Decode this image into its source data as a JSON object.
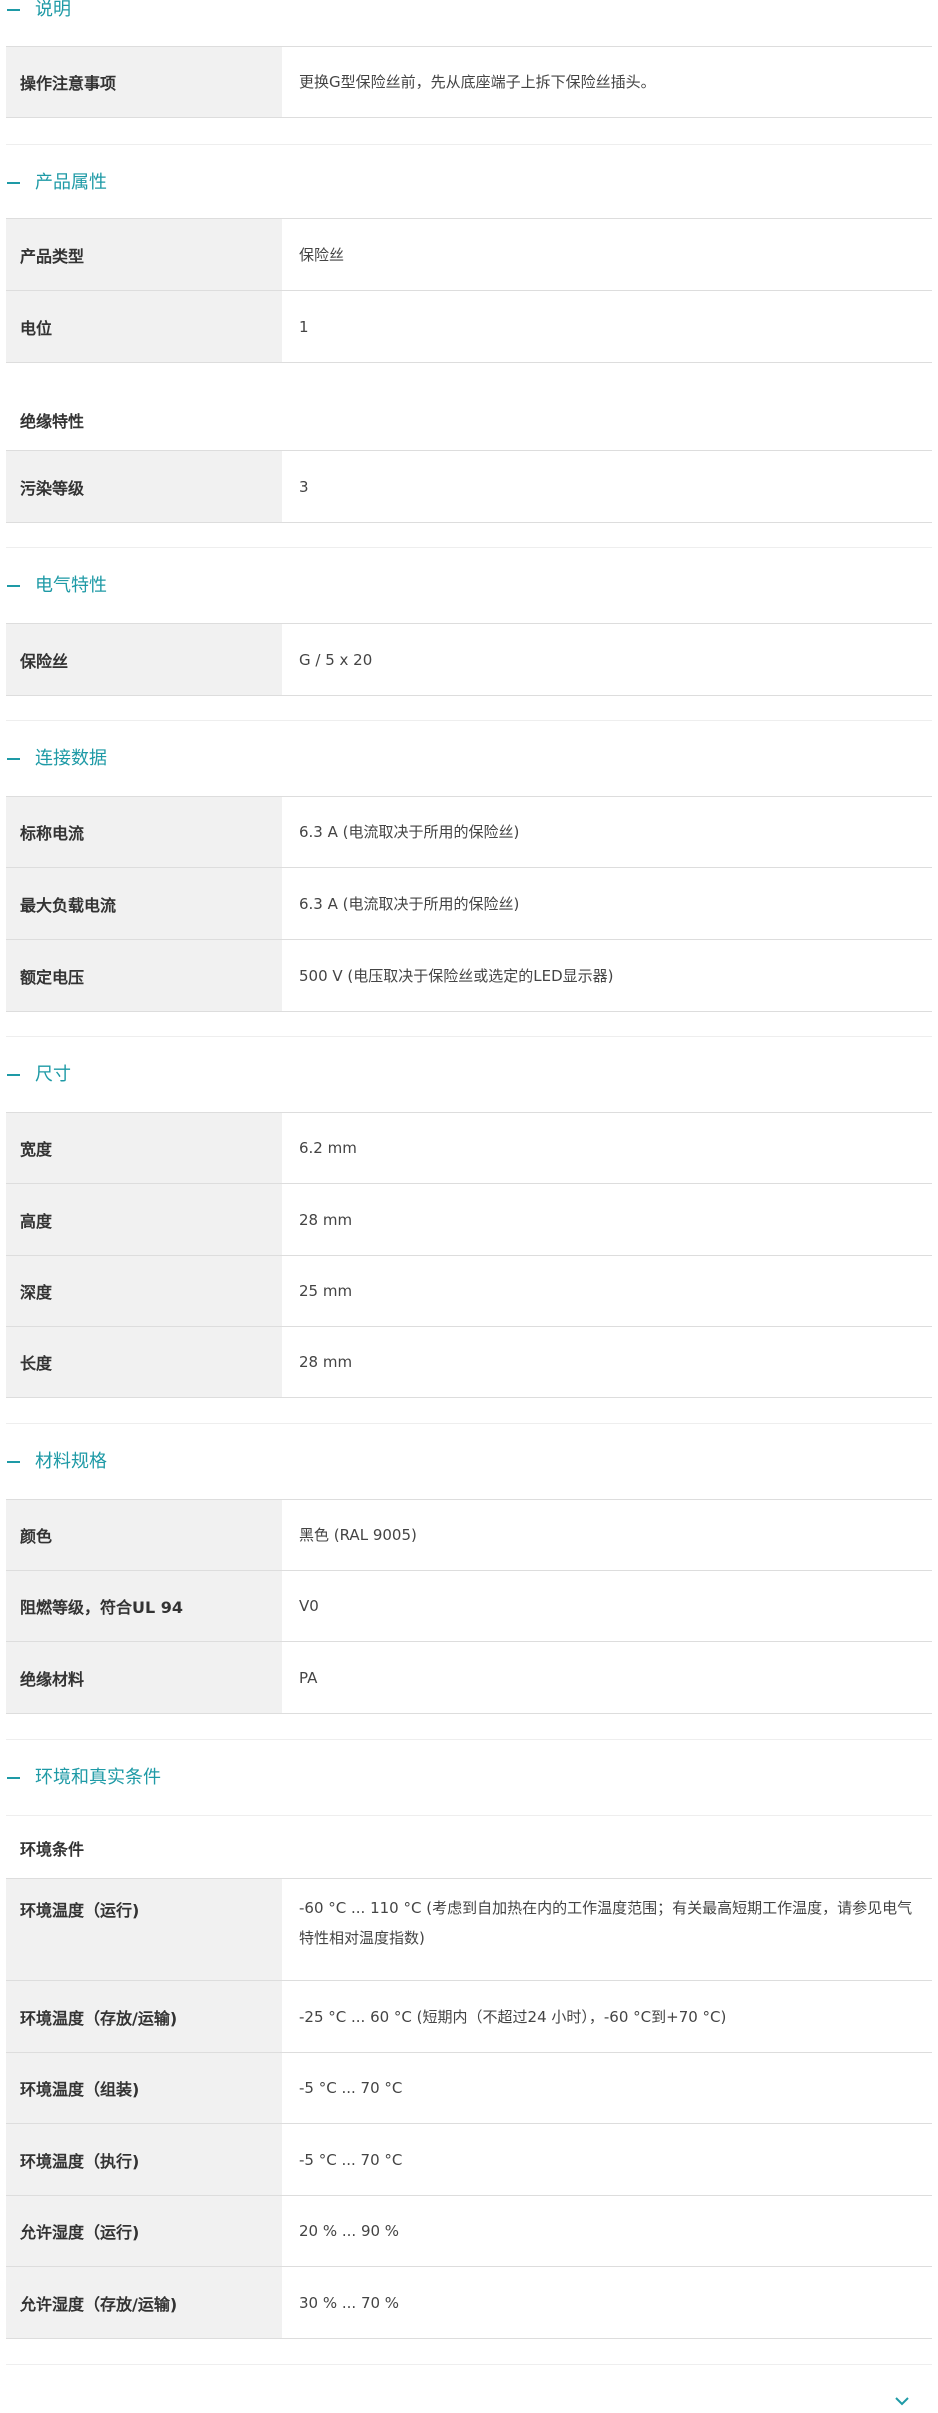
{
  "sections": {
    "description": {
      "title": "说明",
      "rows": [
        {
          "key": "操作注意事项",
          "value": "更换G型保险丝前，先从底座端子上拆下保险丝插头。"
        }
      ]
    },
    "product_properties": {
      "title": "产品属性",
      "rows": [
        {
          "key": "产品类型",
          "value": "保险丝"
        },
        {
          "key": "电位",
          "value": "1"
        }
      ],
      "subhead": "绝缘特性",
      "subrows": [
        {
          "key": "污染等级",
          "value": "3"
        }
      ]
    },
    "electrical": {
      "title": "电气特性",
      "rows": [
        {
          "key": "保险丝",
          "value": "G / 5 x 20"
        }
      ]
    },
    "connection": {
      "title": "连接数据",
      "rows": [
        {
          "key": "标称电流",
          "value": "6.3 A (电流取决于所用的保险丝)"
        },
        {
          "key": "最大负载电流",
          "value": "6.3 A (电流取决于所用的保险丝)"
        },
        {
          "key": "额定电压",
          "value": "500 V (电压取决于保险丝或选定的LED显示器)"
        }
      ]
    },
    "dimensions": {
      "title": "尺寸",
      "rows": [
        {
          "key": "宽度",
          "value": "6.2 mm"
        },
        {
          "key": "高度",
          "value": "28 mm"
        },
        {
          "key": "深度",
          "value": "25 mm"
        },
        {
          "key": "长度",
          "value": "28 mm"
        }
      ]
    },
    "material": {
      "title": "材料规格",
      "rows": [
        {
          "key": "颜色",
          "value": "黑色 (RAL 9005)"
        },
        {
          "key": "阻燃等级，符合UL 94",
          "value": "V0"
        },
        {
          "key": "绝缘材料",
          "value": "PA"
        }
      ]
    },
    "environment": {
      "title": "环境和真实条件",
      "subhead": "环境条件",
      "rows": [
        {
          "key": "环境温度（运行)",
          "value": "-60 °C ... 110 °C (考虑到自加热在内的工作温度范围；有关最高短期工作温度，请参见电气特性相对温度指数)"
        },
        {
          "key": "环境温度（存放/运输)",
          "value": "-25 °C ... 60 °C (短期内（不超过24 小时），-60 °C到+70 °C)"
        },
        {
          "key": "环境温度（组装)",
          "value": "-5 °C ... 70 °C"
        },
        {
          "key": "环境温度（执行)",
          "value": "-5 °C ... 70 °C"
        },
        {
          "key": "允许湿度（运行)",
          "value": "20 % ... 90 %"
        },
        {
          "key": "允许湿度（存放/运输)",
          "value": "30 % ... 70 %"
        }
      ]
    }
  },
  "colors": {
    "accent": "#1e9aa6",
    "key_background": "#f1f1f1",
    "border": "#dddddd"
  },
  "icons": {
    "section_toggle": "minus-icon",
    "scroll_more": "chevron-down-icon"
  }
}
